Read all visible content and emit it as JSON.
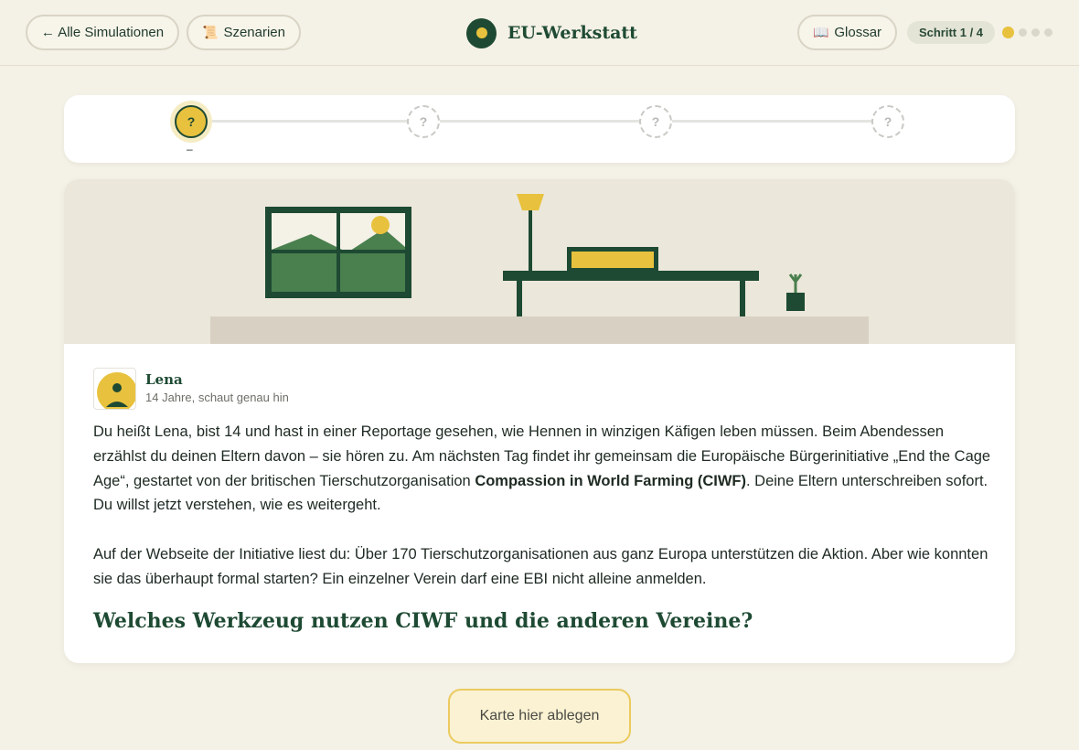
{
  "header": {
    "back_label": "← Alle Simulationen",
    "scenarios_icon": "scroll-icon",
    "scenarios_label": "Szenarien",
    "brand_title": "EU-Werkstatt",
    "glossary_icon": "book-icon",
    "glossary_label": "Glossar",
    "step_label": "Schritt 1 / 4",
    "step_current": 1,
    "step_total": 4
  },
  "progress": {
    "nodes": [
      "?",
      "?",
      "?",
      "?"
    ],
    "current_label": "–"
  },
  "persona": {
    "name": "Lena",
    "subtitle": "14 Jahre, schaut genau hin"
  },
  "story": {
    "p1_a": "Du heißt Lena, bist 14 und hast in einer Reportage gesehen, wie Hennen in winzigen Käfigen leben müssen. Beim Abendessen erzählst du deinen Eltern davon – sie hören zu. Am nächsten Tag findet ihr gemeinsam die Europäische Bürgerinitiative „End the Cage Age“, gestartet von der britischen Tierschutzorganisation ",
    "p1_bold": "Compassion in World Farming (CIWF)",
    "p1_b": ". Deine Eltern unterschreiben sofort. Du willst jetzt verstehen, wie es weitergeht.",
    "p2": "Auf der Webseite der Initiative liest du: Über 170 Tierschutzorganisationen aus ganz Europa unterstützen die Aktion. Aber wie konnten sie das überhaupt formal starten? Ein einzelner Verein darf eine EBI nicht alleine anmelden."
  },
  "question": "Welches Werkzeug nutzen CIWF und die anderen Vereine?",
  "dropzone_label": "Karte hier ablegen",
  "colors": {
    "accent": "#e8c23e",
    "brand": "#1e4a33",
    "background": "#f4f1e6"
  }
}
